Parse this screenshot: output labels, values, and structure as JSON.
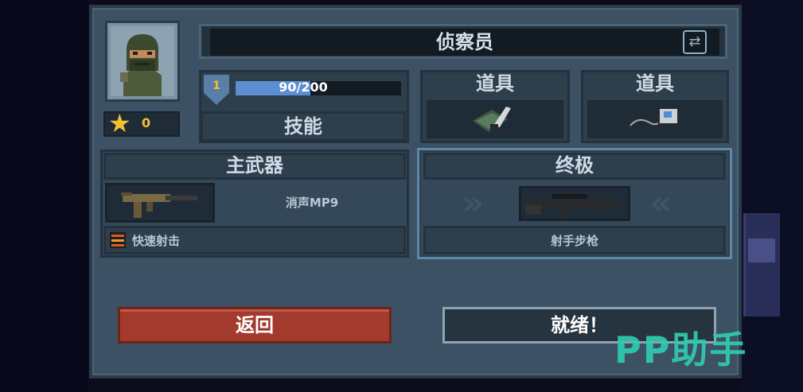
{
  "character": {
    "name": "侦察员",
    "stars": "0"
  },
  "skill": {
    "level": "1",
    "xp_text": "90/200",
    "xp_progress": 0.45,
    "label": "技能"
  },
  "items": [
    {
      "label": "道具",
      "icon": "grenade-knife-icon"
    },
    {
      "label": "道具",
      "icon": "device-cable-icon"
    }
  ],
  "primary_weapon": {
    "header": "主武器",
    "name": "消声MP9",
    "trait": "快速射击",
    "icon": "smg-icon"
  },
  "ultimate": {
    "header": "终极",
    "name": "射手步枪",
    "icon": "sniper-rifle-icon"
  },
  "buttons": {
    "back": "返回",
    "ready": "就绪！"
  },
  "watermark": "PP助手",
  "colors": {
    "panel": "#3c5163",
    "back_button": "#a23a2e",
    "xp_fill": "#5b8fd1",
    "star": "#f2c12e",
    "watermark": "#2fcfb0"
  }
}
